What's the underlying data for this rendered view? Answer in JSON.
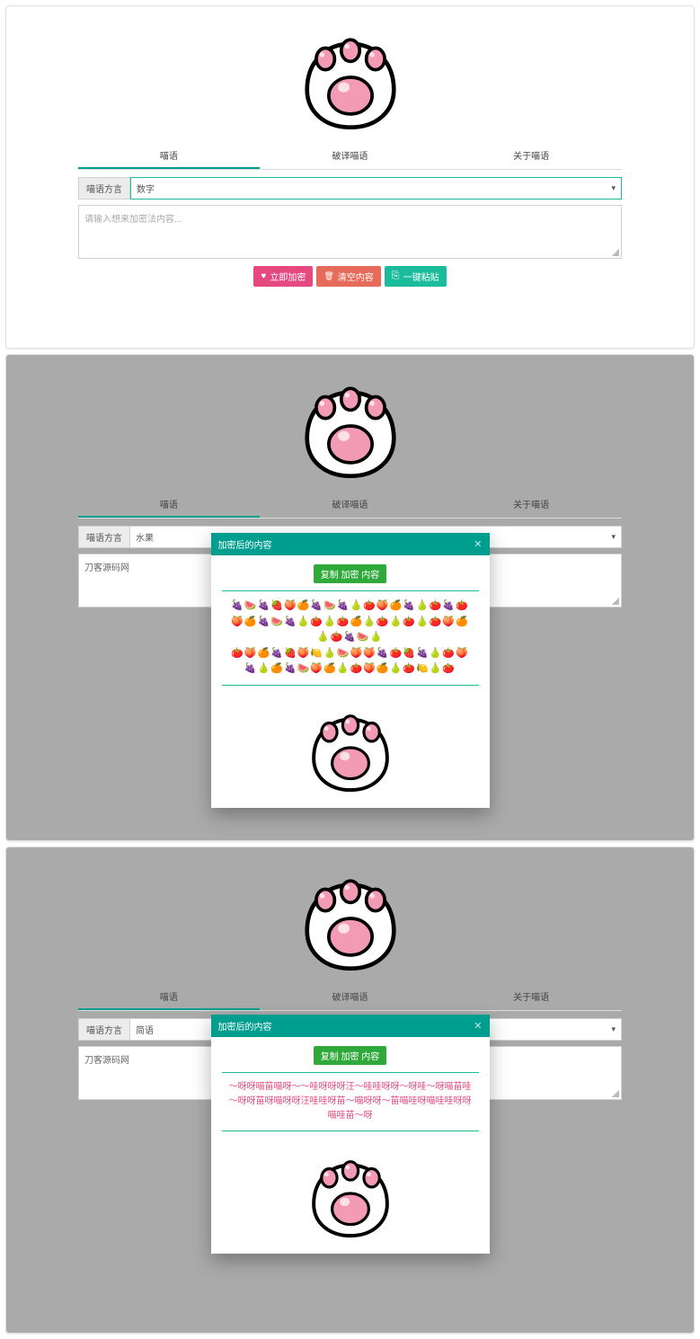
{
  "tabs": {
    "encrypt": "喵语",
    "decrypt": "破译喵语",
    "about": "关于喵语"
  },
  "dialect_label": "喵语方言",
  "panelA": {
    "dialect_value": "数字",
    "placeholder": "请输入想来加密法内容...",
    "btn_encrypt": "立即加密",
    "btn_clear": "清空内容",
    "btn_paste": "一键粘贴"
  },
  "panelB": {
    "dialect_value": "水果",
    "textarea_value": "刀客源码网",
    "modal_title": "加密后的内容",
    "copy_btn": "复制 加密 内容",
    "result_line1": "🍇🍉🍇🍓🍑🍊🍇🍉🍇🍐🍅🍑🍊🍇🍐🍅🍇🍅🍑🍊🍇🍉🍇🍐🍅🍐🍅🍊🍐🍅🍐🍅🍐🍅🍑🍊🍐🍅🍇🍉🍐",
    "result_line2": "🍅🍑🍊🍇🍓🍑🍋🍐🍉🍑🍑🍇🍅🍓🍇🍐🍅🍑🍇🍐🍊🍇🍉🍑🍊🍐🍅🍑🍊🍐🍅🍋🍐🍅"
  },
  "panelC": {
    "dialect_value": "简语",
    "textarea_value": "刀客源码网",
    "modal_title": "加密后的内容",
    "copy_btn": "复制 加密 内容",
    "result_text": "～呀呀喵苗喵呀～～哇呀呀呀汪～哇哇呀呀～呀哇～呀喵苗哇～呀呀苗呀喵呀呀汪哇哇呀苗～喵呀呀～苗喵哇呀喵哇哇呀呀喵哇苗～呀"
  }
}
